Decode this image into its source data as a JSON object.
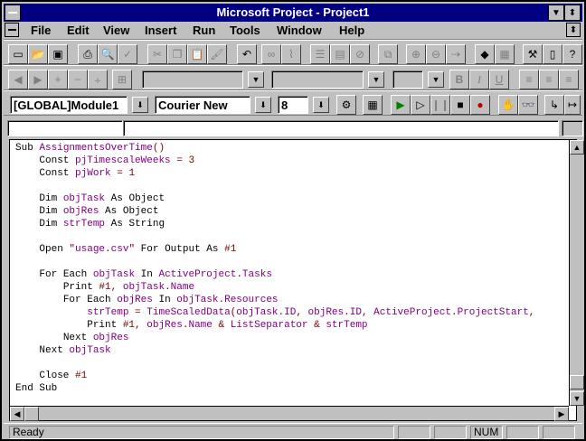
{
  "window": {
    "title": "Microsoft Project - Project1"
  },
  "menu": {
    "file": "File",
    "edit": "Edit",
    "view": "View",
    "insert": "Insert",
    "run": "Run",
    "tools": "Tools",
    "window": "Window",
    "help": "Help"
  },
  "module_toolbar": {
    "module": "[GLOBAL]Module1",
    "font": "Courier New",
    "size": "8"
  },
  "code_lines": [
    "Sub AssignmentsOverTime()",
    "    Const pjTimescaleWeeks = 3",
    "    Const pjWork = 1",
    "",
    "    Dim objTask As Object",
    "    Dim objRes As Object",
    "    Dim strTemp As String",
    "",
    "    Open \"usage.csv\" For Output As #1",
    "",
    "    For Each objTask In ActiveProject.Tasks",
    "        Print #1, objTask.Name",
    "        For Each objRes In objTask.Resources",
    "            strTemp = TimeScaledData(objTask.ID, objRes.ID, ActiveProject.ProjectStart,",
    "            Print #1, objRes.Name & ListSeparator & strTemp",
    "        Next objRes",
    "    Next objTask",
    "",
    "    Close #1",
    "End Sub"
  ],
  "status": {
    "ready": "Ready",
    "num": "NUM"
  },
  "icons": {
    "system_menu": "dash-icon",
    "minimize": "down-triangle-icon",
    "maximize": "up-down-icon"
  }
}
